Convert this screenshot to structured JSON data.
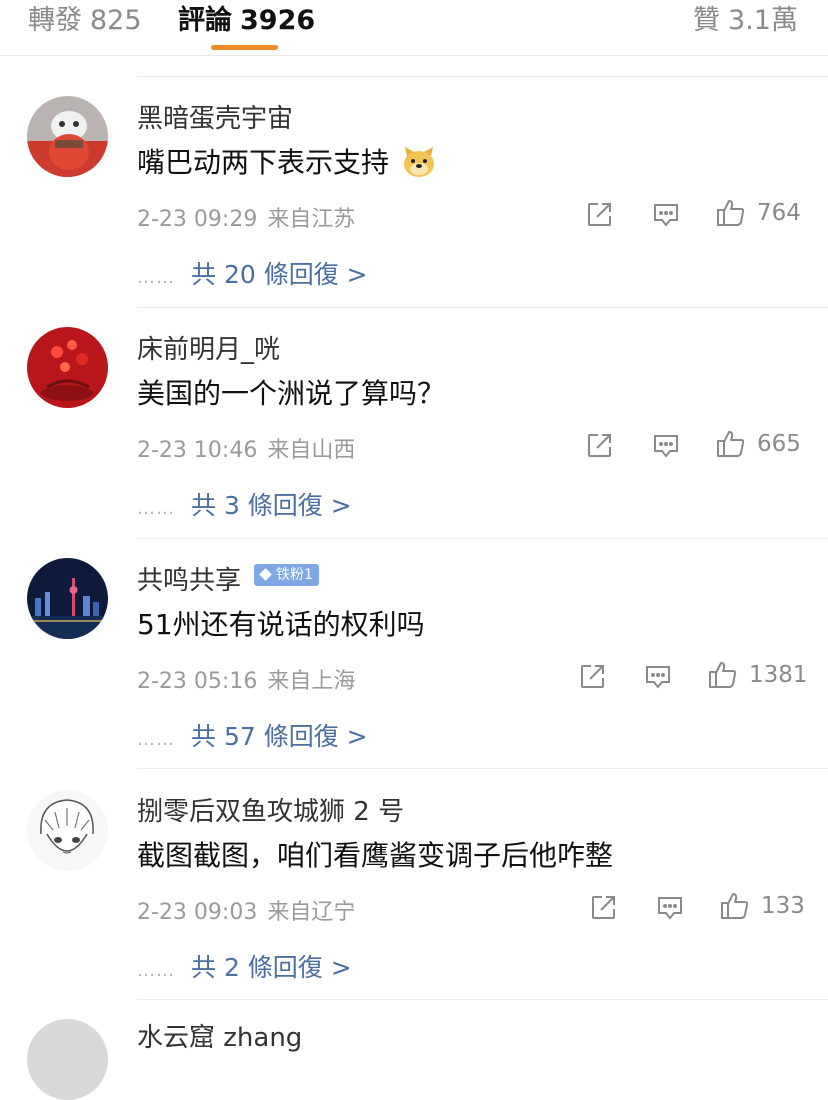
{
  "tabs": {
    "repost_label": "轉發",
    "repost_count": "825",
    "comments_label": "評論",
    "comments_count": "3926",
    "likes_label": "贊",
    "likes_count": "3.1萬"
  },
  "comments": [
    {
      "username": "黑暗蛋壳宇宙",
      "content": "嘴巴动两下表示支持",
      "emoji": "doge-emoji",
      "time": "2-23 09:29",
      "location": "来自江苏",
      "likes": "764",
      "replies": "共 20 條回復 >"
    },
    {
      "username": "床前明月_咣",
      "content": "美国的一个洲说了算吗？",
      "time": "2-23 10:46",
      "location": "来自山西",
      "likes": "665",
      "replies": "共 3 條回復 >"
    },
    {
      "username": "共鸣共享",
      "badge": "铁粉1",
      "content": "51州还有说话的权利吗",
      "time": "2-23 05:16",
      "location": "来自上海",
      "likes": "1381",
      "replies": "共 57 條回復 >"
    },
    {
      "username": "捌零后双鱼攻城狮 2 号",
      "content": "截图截图，咱们看鹰酱变调子后他咋整",
      "time": "2-23 09:03",
      "location": "来自辽宁",
      "likes": "133",
      "replies": "共 2 條回復 >"
    },
    {
      "username": "水云窟 zhang"
    }
  ],
  "reply_dots": "……",
  "icons": {
    "share": "share-icon",
    "comment": "comment-icon",
    "like": "thumbs-up-icon"
  },
  "colors": {
    "accent": "#f08a29",
    "link": "#4a6fa0",
    "badge": "#7fa7e6"
  }
}
